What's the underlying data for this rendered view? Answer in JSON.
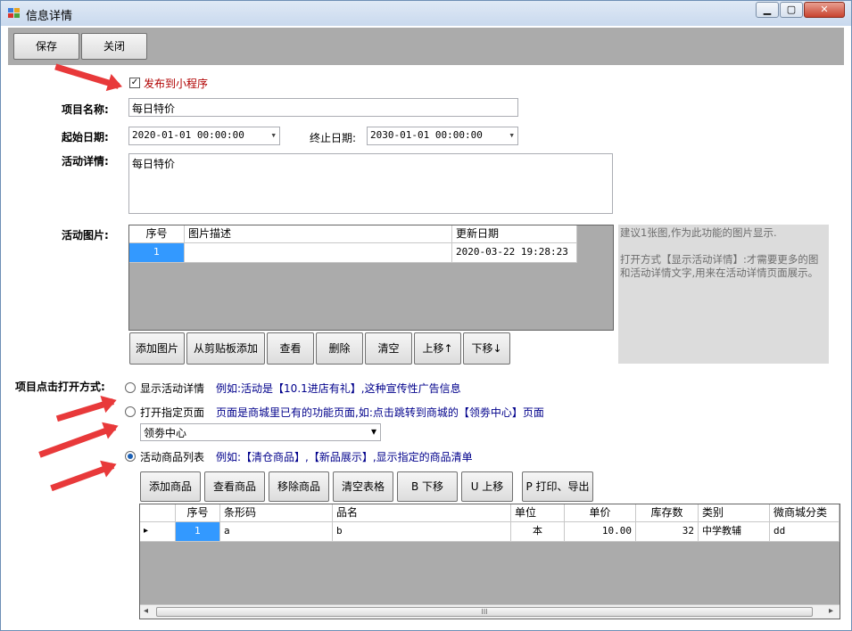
{
  "window": {
    "title": "信息详情",
    "minimize_glyph": "▁",
    "maximize_glyph": "▢",
    "close_glyph": "✕"
  },
  "toolbar": {
    "save_label": "保存",
    "close_label": "关闭"
  },
  "form": {
    "publish_label": "发布到小程序",
    "publish_checked": true,
    "check_glyph": "✓",
    "name_label": "项目名称:",
    "name_value": "每日特价",
    "start_label": "起始日期:",
    "start_value": "2020-01-01 00:00:00",
    "end_label": "终止日期:",
    "end_value": "2030-01-01 00:00:00",
    "dropdown_glyph": "▾",
    "detail_label": "活动详情:",
    "detail_value": "每日特价",
    "image_label": "活动图片:"
  },
  "image_grid": {
    "headers": [
      "序号",
      "图片描述",
      "更新日期"
    ],
    "rows": [
      {
        "index": "1",
        "desc": "",
        "date": "2020-03-22 19:28:23"
      }
    ]
  },
  "image_buttons": [
    "添加图片",
    "从剪贴板添加",
    "查看",
    "删除",
    "清空",
    "上移↑",
    "下移↓"
  ],
  "hint": {
    "line1": "建议1张图,作为此功能的图片显示.",
    "line2": "打开方式【显示活动详情】:才需要更多的图和活动详情文字,用来在活动详情页面展示。"
  },
  "open_mode": {
    "label": "项目点击打开方式:",
    "options": [
      {
        "label": "显示活动详情",
        "desc": "例如:活动是【10.1进店有礼】,这种宣传性广告信息",
        "selected": false
      },
      {
        "label": "打开指定页面",
        "desc": "页面是商城里已有的功能页面,如:点击跳转到商城的【领劵中心】页面",
        "selected": false
      },
      {
        "label": "活动商品列表",
        "desc": "例如:【清仓商品】,【新品展示】,显示指定的商品清单",
        "selected": true
      }
    ],
    "page_select_value": "领劵中心"
  },
  "product_buttons": [
    "添加商品",
    "查看商品",
    "移除商品",
    "清空表格",
    "B 下移",
    "U 上移",
    "P 打印、导出"
  ],
  "product_grid": {
    "headers": [
      "序号",
      "条形码",
      "品名",
      "单位",
      "单价",
      "库存数",
      "类别",
      "微商城分类"
    ],
    "rows": [
      {
        "index": "1",
        "barcode": "a",
        "name": "b",
        "unit": "本",
        "price": "10.00",
        "stock": "32",
        "category": "中学教辅",
        "wx_category": "dd"
      }
    ],
    "row_marker": "▸",
    "scroll_left": "◂",
    "scroll_right": "▸",
    "scroll_grip": "III"
  },
  "colors": {
    "accent_arrow": "#e8393a",
    "toolbar_bg": "#ababab",
    "selected_cell": "#3399ff",
    "desc_text": "#00008b",
    "publish_text": "#b00000"
  }
}
